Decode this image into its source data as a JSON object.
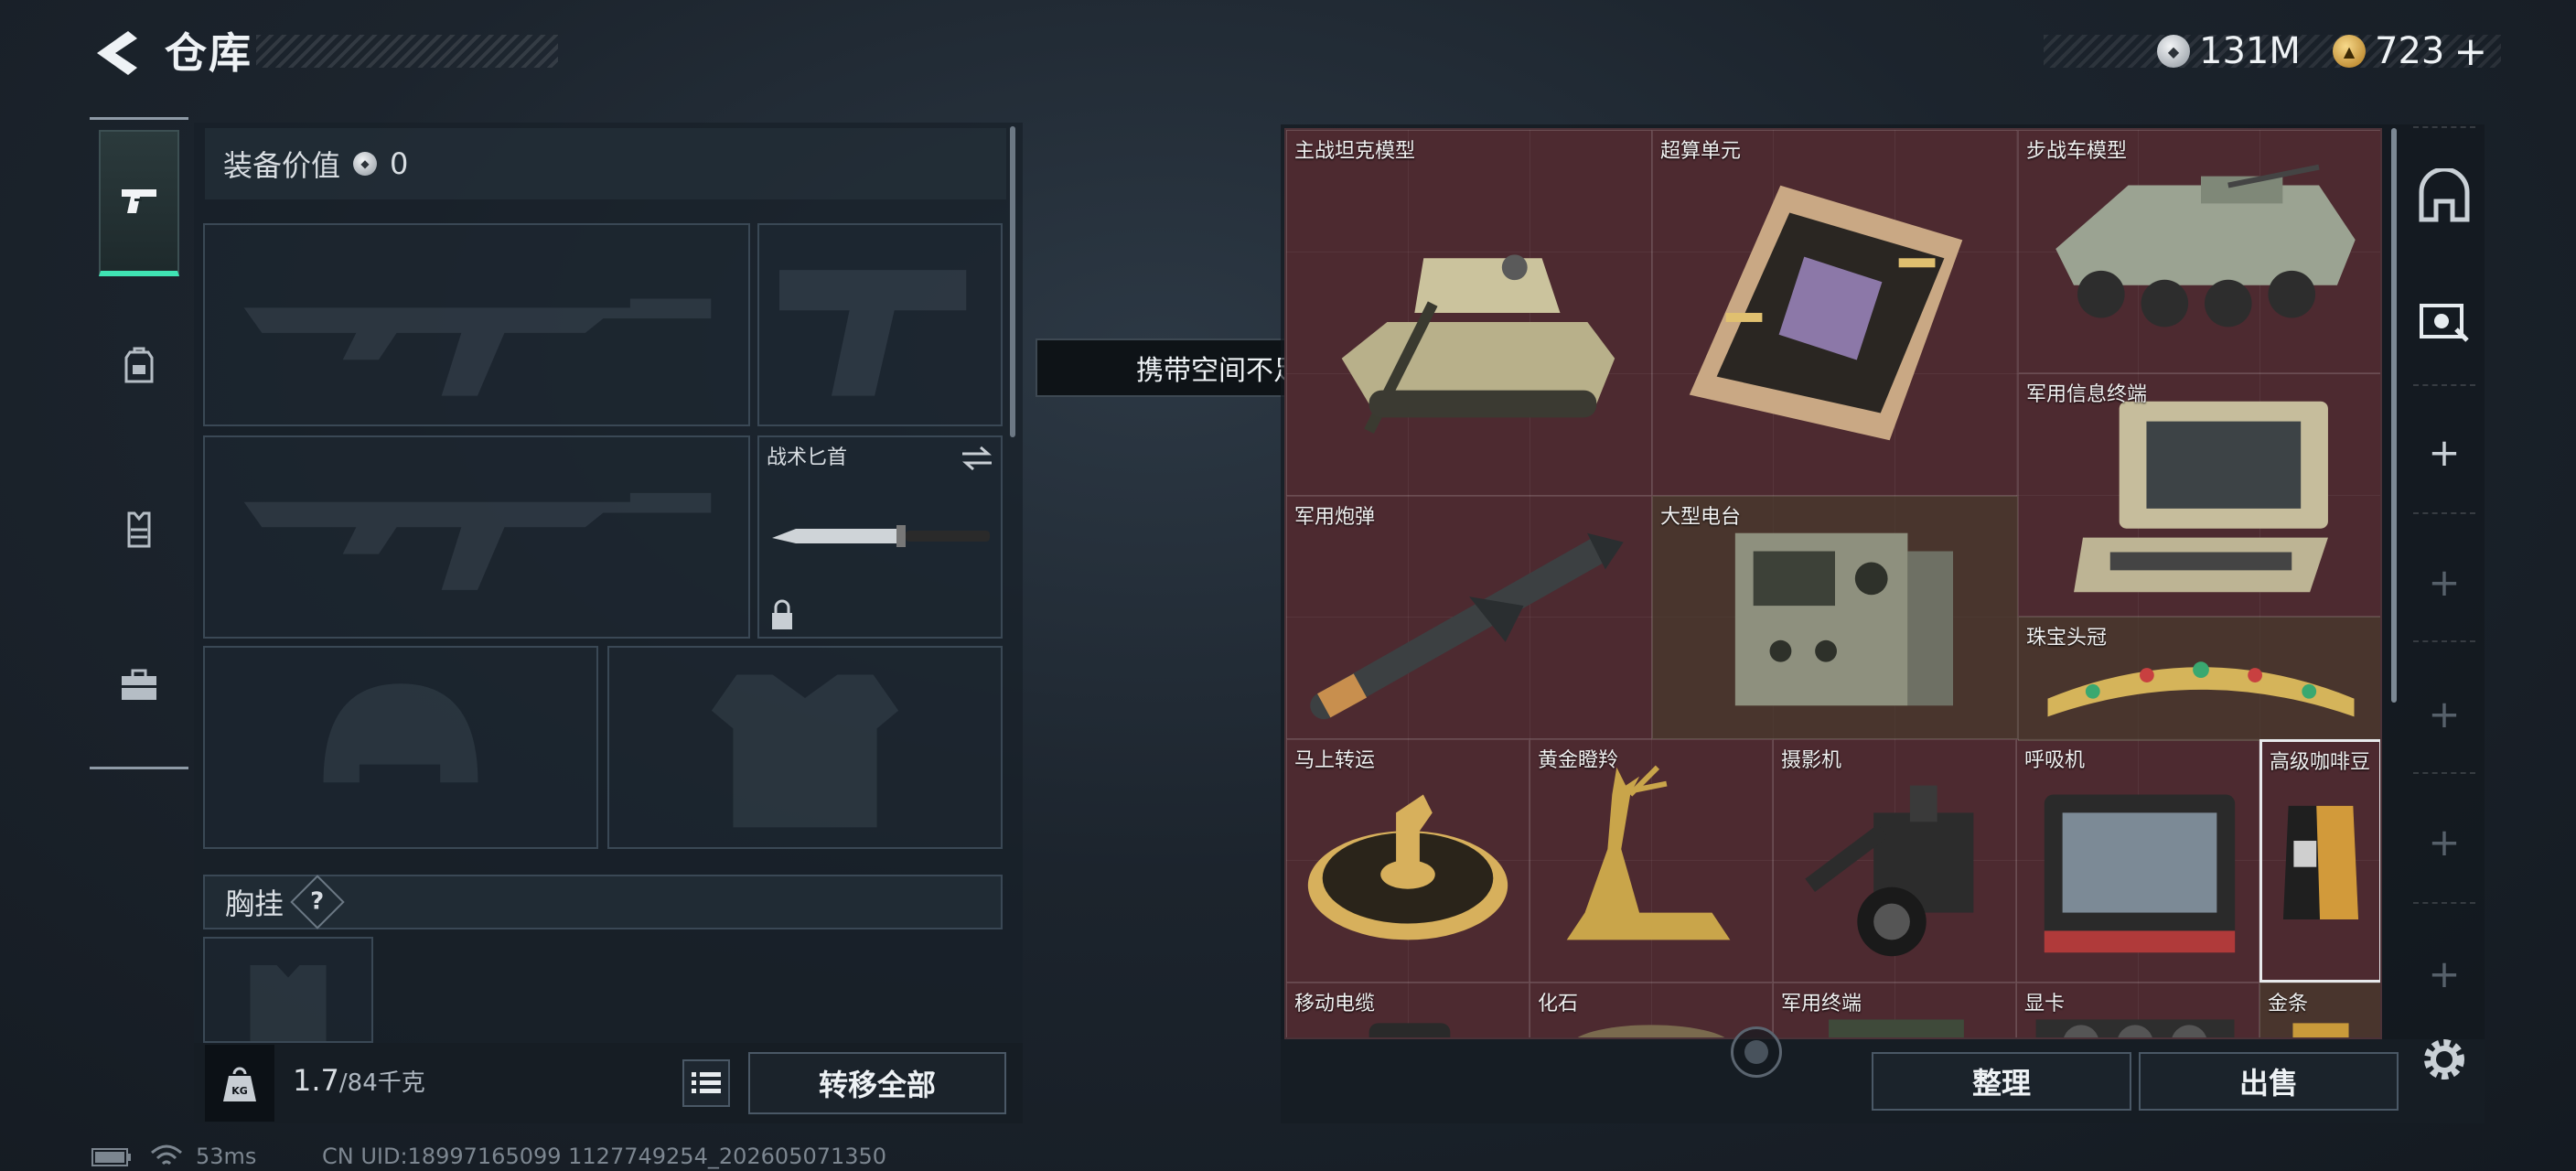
{
  "header": {
    "title": "仓库",
    "silver_value": "131M",
    "gold_value": "723",
    "gold_add": "+"
  },
  "nav": {
    "tabs": [
      {
        "name": "weapons",
        "icon": "pistol-icon",
        "active": true
      },
      {
        "name": "backpack",
        "icon": "backpack-icon",
        "active": false
      },
      {
        "name": "vest",
        "icon": "vest-icon",
        "active": false
      },
      {
        "name": "case",
        "icon": "briefcase-icon",
        "active": false
      }
    ]
  },
  "equipment": {
    "value_label": "装备价值",
    "value": "0",
    "knife_label": "战术匕首",
    "chest_label": "胸挂",
    "chest_help": "?",
    "weight_current": "1.7",
    "weight_max": "/84千克",
    "transfer_all": "转移全部"
  },
  "tooltip": "携带空间不足，需要容量",
  "storage": {
    "items": [
      {
        "label": "主战坦克模型",
        "icon": "tank-icon"
      },
      {
        "label": "超算单元",
        "icon": "circuit-board-icon"
      },
      {
        "label": "步战车模型",
        "icon": "ifv-icon"
      },
      {
        "label": "军用信息终端",
        "icon": "terminal-icon"
      },
      {
        "label": "军用炮弹",
        "icon": "missile-icon"
      },
      {
        "label": "大型电台",
        "icon": "radio-icon"
      },
      {
        "label": "珠宝头冠",
        "icon": "tiara-icon"
      },
      {
        "label": "马上转运",
        "icon": "horse-disc-icon"
      },
      {
        "label": "黄金瞪羚",
        "icon": "gazelle-icon"
      },
      {
        "label": "摄影机",
        "icon": "camera-icon"
      },
      {
        "label": "呼吸机",
        "icon": "ventilator-icon"
      },
      {
        "label": "高级咖啡豆",
        "icon": "coffee-bag-icon"
      },
      {
        "label": "移动电缆",
        "icon": "cable-icon"
      },
      {
        "label": "化石",
        "icon": "fossil-icon"
      },
      {
        "label": "军用终端",
        "icon": "tablet-icon"
      },
      {
        "label": "显卡",
        "icon": "gpu-icon"
      },
      {
        "label": "金条",
        "icon": "gold-bar-icon"
      }
    ],
    "sort_button": "整理",
    "sell_button": "出售"
  },
  "status_bar": {
    "ping": "53ms",
    "uid": "CN UID:18997165099 1127749254_202605071350"
  },
  "colors": {
    "accent": "#3fe3b3",
    "storage_bg": "#4d2a30",
    "panel_bg": "#182028"
  }
}
